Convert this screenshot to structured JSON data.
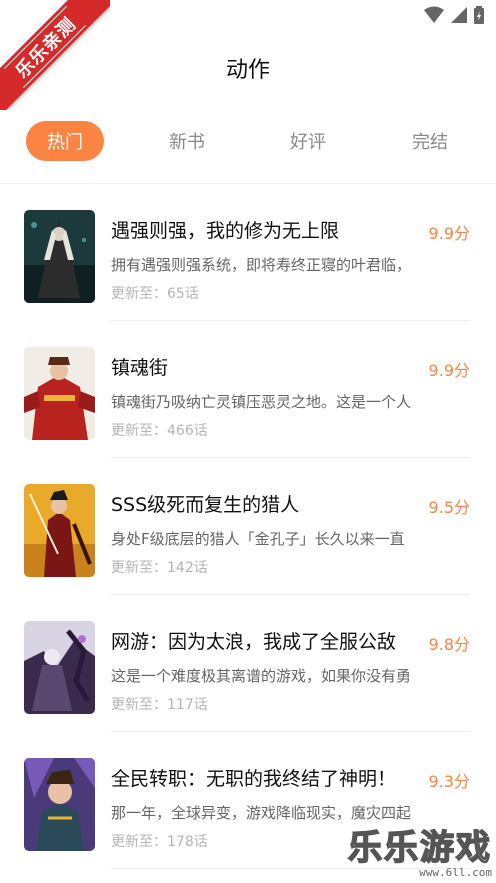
{
  "ribbon": {
    "label": "乐乐亲测"
  },
  "header": {
    "title": "动作"
  },
  "tabs": [
    {
      "label": "热门",
      "active": true
    },
    {
      "label": "新书",
      "active": false
    },
    {
      "label": "好评",
      "active": false
    },
    {
      "label": "完结",
      "active": false
    }
  ],
  "colors": {
    "accent": "#fb8442",
    "ribbon": "#d42a2a"
  },
  "comics": [
    {
      "title": "遇强则强，我的修为无上限",
      "score": "9.9分",
      "desc": "拥有遇强则强系统，即将寿终正寝的叶君临，",
      "update": "更新至：65话"
    },
    {
      "title": "镇魂街",
      "score": "9.9分",
      "desc": "镇魂街乃吸纳亡灵镇压恶灵之地。这是一个人",
      "update": "更新至：466话"
    },
    {
      "title": "SSS级死而复生的猎人",
      "score": "9.5分",
      "desc": "身处F级底层的猎人「金孔子」长久以来一直",
      "update": "更新至：142话"
    },
    {
      "title": "网游：因为太浪，我成了全服公敌",
      "score": "9.8分",
      "desc": "这是一个难度极其离谱的游戏，如果你没有勇",
      "update": "更新至：117话"
    },
    {
      "title": "全民转职：无职的我终结了神明！",
      "score": "9.3分",
      "desc": "那一年，全球异变，游戏降临现实，魔灾四起",
      "update": "更新至：178话"
    }
  ],
  "watermark": {
    "main": "乐乐游戏",
    "url": "www.6ll.com"
  }
}
